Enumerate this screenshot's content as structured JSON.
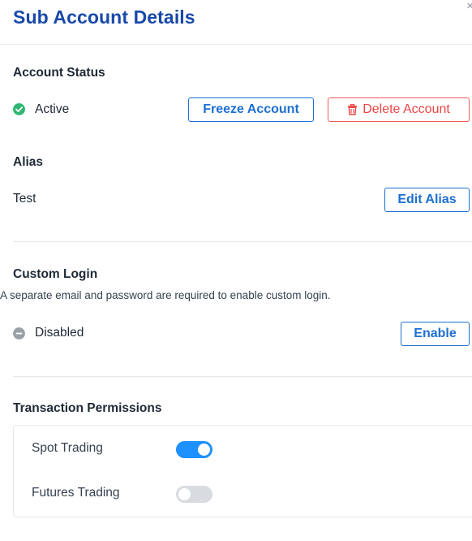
{
  "header": {
    "title": "Sub Account Details",
    "close_glyph": "×"
  },
  "account_status": {
    "heading": "Account Status",
    "status": "Active",
    "status_icon": "check-circle-icon",
    "status_color": "#2eb872",
    "freeze_label": "Freeze Account",
    "delete_label": "Delete Account",
    "delete_icon": "trash-icon"
  },
  "alias": {
    "heading": "Alias",
    "value": "Test",
    "edit_label": "Edit Alias"
  },
  "custom_login": {
    "heading": "Custom Login",
    "description": "A separate email and password are required to enable custom login.",
    "status": "Disabled",
    "status_icon": "minus-circle-icon",
    "enable_label": "Enable"
  },
  "permissions": {
    "heading": "Transaction Permissions",
    "items": [
      {
        "label": "Spot Trading",
        "enabled": true
      },
      {
        "label": "Futures Trading",
        "enabled": false
      }
    ]
  },
  "colors": {
    "title_blue": "#1849a9",
    "button_blue": "#1d6fd1",
    "danger_red": "#ef4444",
    "toggle_on": "#1e90ff",
    "toggle_off": "#d8dbe0"
  }
}
